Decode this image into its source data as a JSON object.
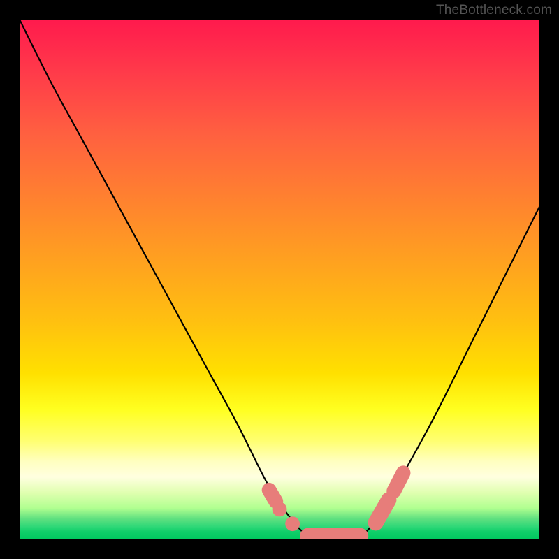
{
  "watermark": "TheBottleneck.com",
  "chart_data": {
    "type": "line",
    "title": "",
    "xlabel": "",
    "ylabel": "",
    "xlim": [
      0,
      100
    ],
    "ylim": [
      0,
      100
    ],
    "series": [
      {
        "name": "curve",
        "x": [
          0,
          6,
          12,
          18,
          24,
          30,
          36,
          42,
          47,
          50,
          53,
          55,
          57,
          60,
          63,
          66,
          68,
          70,
          74,
          80,
          88,
          96,
          100
        ],
        "y": [
          100,
          88,
          77,
          66,
          55,
          44,
          33,
          22,
          12,
          7,
          3,
          1,
          0,
          0,
          0,
          1,
          3,
          6,
          13,
          24,
          40,
          56,
          64
        ]
      }
    ],
    "markers": [
      {
        "shape": "pill",
        "x1": 55.5,
        "y1": 0.6,
        "x2": 65.5,
        "y2": 0.6,
        "color": "#e77d7a",
        "stroke_w": 3.2
      },
      {
        "shape": "circle",
        "x": 50.0,
        "y": 5.8,
        "r": 1.4,
        "color": "#e77d7a"
      },
      {
        "shape": "circle",
        "x": 52.5,
        "y": 3.0,
        "r": 1.4,
        "color": "#e77d7a"
      },
      {
        "shape": "pill",
        "x1": 48.0,
        "y1": 9.5,
        "x2": 49.3,
        "y2": 7.3,
        "color": "#e77d7a",
        "stroke_w": 2.8
      },
      {
        "shape": "pill",
        "x1": 68.5,
        "y1": 3.2,
        "x2": 71.0,
        "y2": 7.6,
        "color": "#e77d7a",
        "stroke_w": 3.0
      },
      {
        "shape": "pill",
        "x1": 72.0,
        "y1": 9.3,
        "x2": 73.8,
        "y2": 12.8,
        "color": "#e77d7a",
        "stroke_w": 2.8
      }
    ],
    "gradient_stops": [
      {
        "pct": 0,
        "color": "#ff1a4d"
      },
      {
        "pct": 22,
        "color": "#ff6040"
      },
      {
        "pct": 46,
        "color": "#ffa020"
      },
      {
        "pct": 75,
        "color": "#ffff20"
      },
      {
        "pct": 88,
        "color": "#ffffe0"
      },
      {
        "pct": 100,
        "color": "#00c85f"
      }
    ]
  }
}
